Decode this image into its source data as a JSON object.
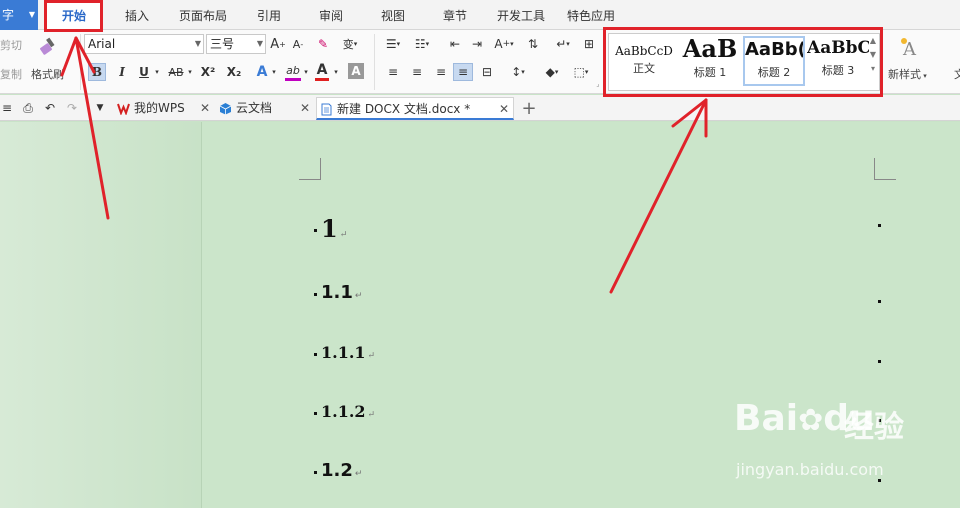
{
  "app_button": {
    "label": "字"
  },
  "menu_tabs": [
    "开始",
    "插入",
    "页面布局",
    "引用",
    "审阅",
    "视图",
    "章节",
    "开发工具",
    "特色应用"
  ],
  "ribbon": {
    "clipboard": {
      "cut": "剪切",
      "copy": "复制",
      "format_painter": "格式刷"
    },
    "font": {
      "family": "Arial",
      "size": "三号"
    },
    "format_buttons": {
      "bold": "B",
      "italic": "I",
      "underline": "U",
      "strike": "AB",
      "superscript": "X²",
      "subscript": "X₂",
      "text_effect": "A",
      "highlight": "ab",
      "font_color": "A",
      "char_shading": "A"
    },
    "styles": [
      {
        "sample": "AaBbCcD",
        "name": "正文"
      },
      {
        "sample": "AaB",
        "name": "标题 1"
      },
      {
        "sample": "AaBb(",
        "name": "标题 2"
      },
      {
        "sample": "AaBbC",
        "name": "标题 3"
      }
    ],
    "new_style": "新样式",
    "text_tool": "文"
  },
  "doc_tabs": [
    {
      "label": "我的WPS",
      "icon": "wps-logo-icon"
    },
    {
      "label": "云文档",
      "icon": "cloud-doc-icon"
    },
    {
      "label": "新建 DOCX 文档.docx *",
      "icon": "docx-file-icon"
    }
  ],
  "document": {
    "headings": [
      "1",
      "1.1",
      "1.1.1",
      "1.1.2",
      "1.2"
    ],
    "paragraph_mark": "↵"
  },
  "watermark": {
    "logo": "Bai",
    "logo_end": "du",
    "name": "经验",
    "url": "jingyan.baidu.com"
  },
  "colors": {
    "accent": "#3a7bd5",
    "annotation_red": "#e0222a",
    "document_bg": "#cbe5ca",
    "font_color_bar": "#e02020",
    "highlight_bar": "#c000c0"
  }
}
